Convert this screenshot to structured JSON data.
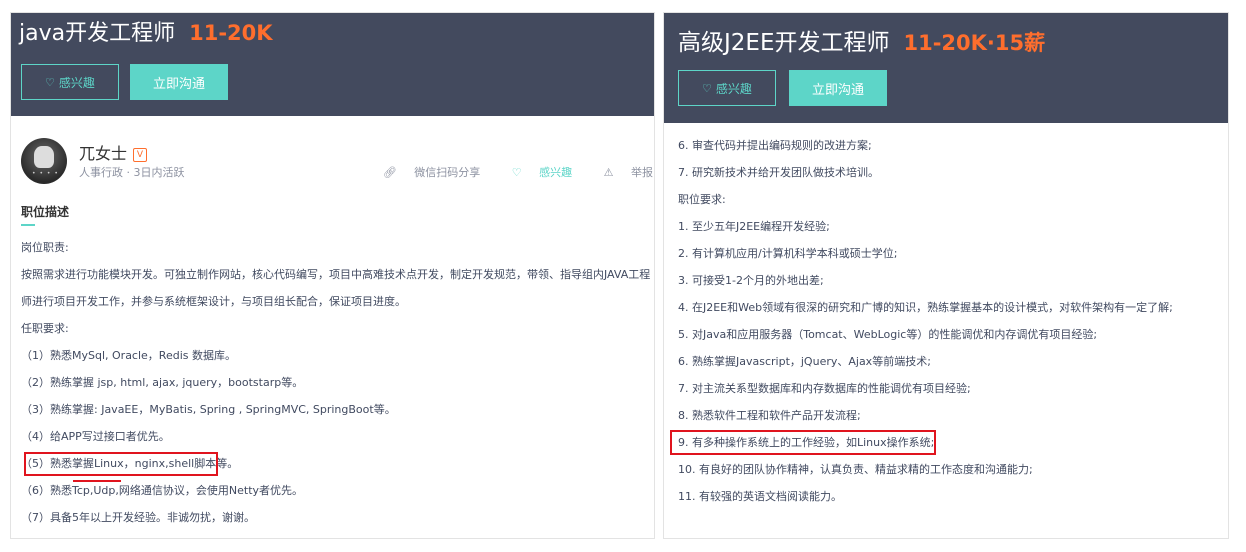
{
  "left": {
    "title": "java开发工程师",
    "salary": "11-20K",
    "btn_interest": "感兴趣",
    "btn_chat": "立即沟通",
    "poster": {
      "name": "兀女士",
      "badge": "V",
      "meta": "人事行政 · 3日内活跃",
      "share": "微信扫码分享",
      "interest": "感兴趣",
      "report": "举报"
    },
    "section_title": "职位描述",
    "lines": [
      "岗位职责:",
      "按照需求进行功能模块开发。可独立制作网站，核心代码编写，项目中高难技术点开发，制定开发规范，带领、指导组内JAVA工程师进行项目开发工作，并参与系统框架设计，与项目组长配合，保证项目进度。",
      "任职要求:",
      "（1）熟悉MySql, Oracle，Redis 数据库。",
      "（2）熟练掌握 jsp, html, ajax, jquery，bootstarp等。",
      "（3）熟练掌握: JavaEE，MyBatis, Spring , SpringMVC, SpringBoot等。",
      "（4）给APP写过接口者优先。",
      "（5）熟悉掌握Linux，nginx,shell脚本等。",
      "（6）熟悉Tcp,Udp,网络通信协议，会使用Netty者优先。",
      "（7）具备5年以上开发经验。非诚勿扰，谢谢。"
    ]
  },
  "right": {
    "title": "高级J2EE开发工程师",
    "salary": "11-20K·15薪",
    "btn_interest": "感兴趣",
    "btn_chat": "立即沟通",
    "lines": [
      "6. 审查代码并提出编码规则的改进方案;",
      "7. 研究新技术并给开发团队做技术培训。",
      "职位要求:",
      "1. 至少五年J2EE编程开发经验;",
      "2. 有计算机应用/计算机科学本科或硕士学位;",
      "3. 可接受1-2个月的外地出差;",
      "4. 在J2EE和Web领域有很深的研究和广博的知识，熟练掌握基本的设计模式，对软件架构有一定了解;",
      "5. 对Java和应用服务器（Tomcat、WebLogic等）的性能调优和内存调优有项目经验;",
      "6. 熟练掌握Javascript，jQuery、Ajax等前端技术;",
      "7. 对主流关系型数据库和内存数据库的性能调优有项目经验;",
      "8. 熟悉软件工程和软件产品开发流程;",
      "9. 有多种操作系统上的工作经验，如Linux操作系统;",
      "10. 有良好的团队协作精神，认真负责、精益求精的工作态度和沟通能力;",
      "11. 有较强的英语文档阅读能力。"
    ]
  }
}
